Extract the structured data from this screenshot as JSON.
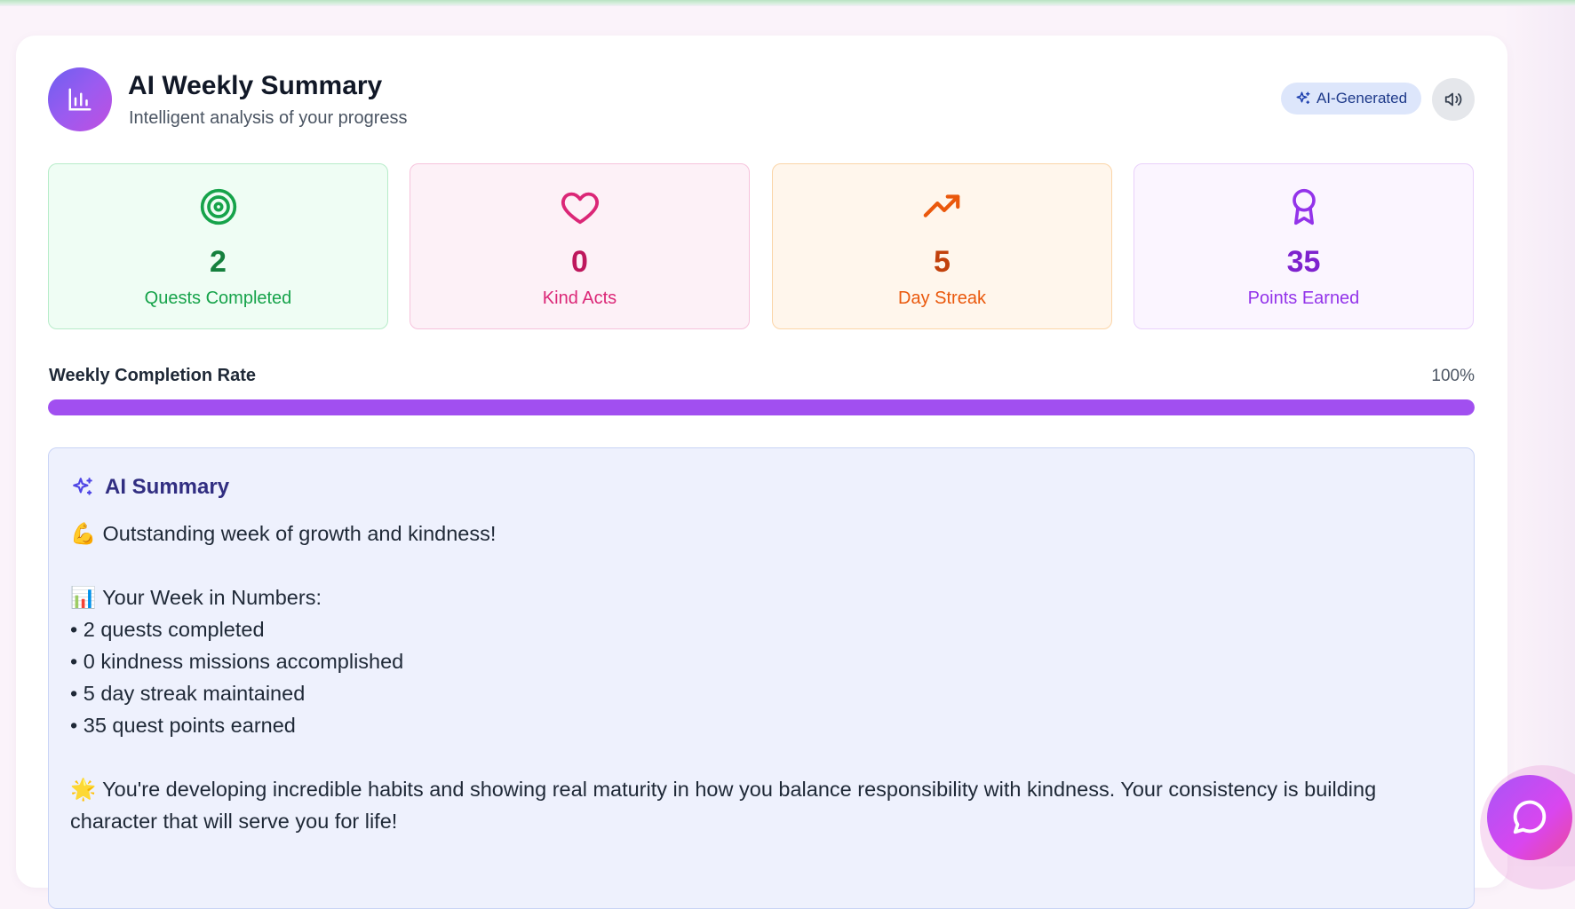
{
  "header": {
    "title": "AI Weekly Summary",
    "subtitle": "Intelligent analysis of your progress",
    "logo_icon": "bar-chart-icon",
    "badge_label": "AI-Generated",
    "badge_icon": "sparkles-icon",
    "sound_icon": "speaker-icon"
  },
  "stats": [
    {
      "value": "2",
      "label": "Quests Completed",
      "icon": "target-icon",
      "color": "#16a34a"
    },
    {
      "value": "0",
      "label": "Kind Acts",
      "icon": "heart-icon",
      "color": "#db2777"
    },
    {
      "value": "5",
      "label": "Day Streak",
      "icon": "trending-up-icon",
      "color": "#ea580c"
    },
    {
      "value": "35",
      "label": "Points Earned",
      "icon": "award-icon",
      "color": "#9333ea"
    }
  ],
  "completion": {
    "label": "Weekly Completion Rate",
    "value_text": "100%",
    "fraction": 1.0,
    "color": "#a14ff0"
  },
  "summary": {
    "title": "AI Summary",
    "icon": "sparkles-icon",
    "intro_emoji": "💪",
    "intro": "Outstanding week of growth and kindness!",
    "numbers_emoji": "📊",
    "numbers_heading": "Your Week in Numbers:",
    "bullets": [
      "• 2 quests completed",
      "• 0 kindness missions accomplished",
      "• 5 day streak maintained",
      "• 35 quest points earned"
    ],
    "closing_emoji": "🌟",
    "closing": "You're developing incredible habits and showing real maturity in how you balance responsibility with kindness. Your consistency is building character that will serve you for life!"
  },
  "chat": {
    "icon": "chat-bubble-icon"
  }
}
